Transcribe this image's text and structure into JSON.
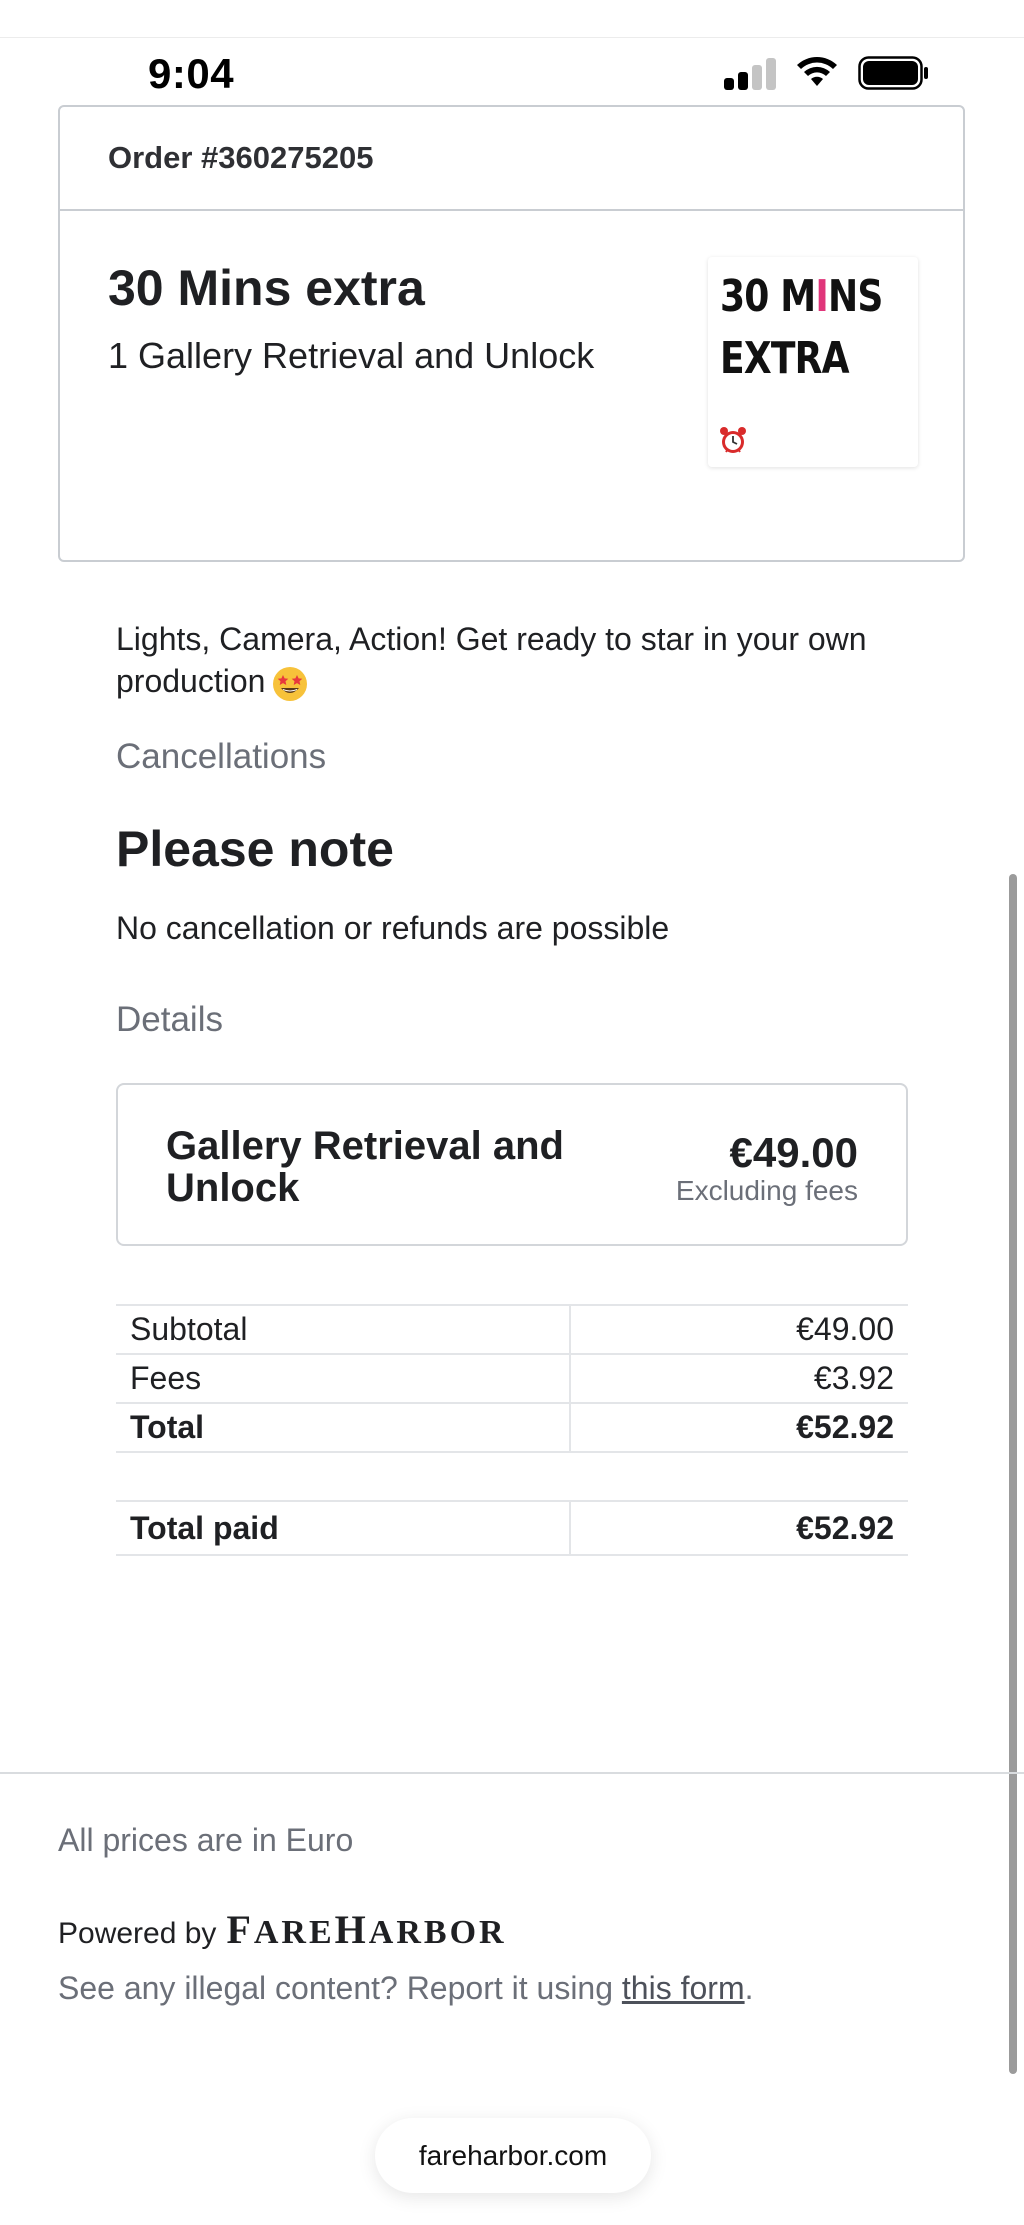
{
  "status_bar": {
    "time": "9:04",
    "icons": [
      "signal-icon",
      "wifi-icon",
      "battery-icon"
    ]
  },
  "order": {
    "number": "Order #360275205",
    "product_title": "30 Mins extra",
    "product_subtitle": "1 Gallery Retrieval and Unlock",
    "thumbnail": {
      "line1_pre": "30 M",
      "line1_accent": "I",
      "line1_post": "NS",
      "line2": "EXTRA",
      "accent_color": "#e0357a",
      "icon": "alarm-clock-icon"
    }
  },
  "description": "Lights, Camera, Action! Get ready to star in your own production",
  "description_emoji": "star-struck-face-icon",
  "cancellations": {
    "label": "Cancellations",
    "heading": "Please note",
    "text": "No cancellation or refunds are possible"
  },
  "details": {
    "label": "Details",
    "item_name": "Gallery Retrieval and Unlock",
    "price": "€49.00",
    "price_note": "Excluding fees"
  },
  "totals": [
    {
      "label": "Subtotal",
      "amount": "€49.00"
    },
    {
      "label": "Fees",
      "amount": "€3.92"
    },
    {
      "label": "Total",
      "amount": "€52.92"
    }
  ],
  "total_paid": {
    "label": "Total paid",
    "amount": "€52.92"
  },
  "footer": {
    "prices_note": "All prices are in Euro",
    "powered_by": "Powered by",
    "brand_f": "F",
    "brand_are": "ARE",
    "brand_h": "H",
    "brand_arbor": "ARBOR",
    "report_prefix": "See any illegal content? Report it using ",
    "report_link": "this form",
    "report_suffix": "."
  },
  "url_bar": {
    "domain": "fareharbor.com"
  },
  "colors": {
    "text": "#1f2023",
    "muted": "#6b6f78",
    "border": "#c9cdd2",
    "accent": "#e0357a"
  }
}
